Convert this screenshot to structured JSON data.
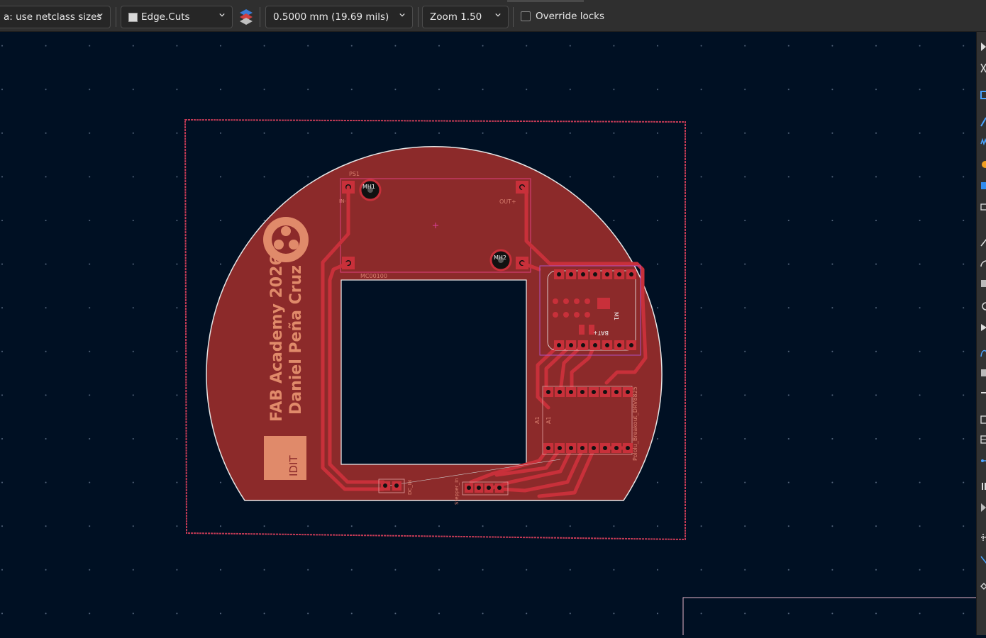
{
  "toolbar": {
    "track_size": "a: use netclass sizes",
    "layer": "Edge.Cuts",
    "grid": "0.5000 mm (19.69 mils)",
    "zoom": "Zoom 1.50",
    "override_locks": "Override locks",
    "override_locks_checked": false
  },
  "board": {
    "silk_title": "FAB Academy 2026",
    "silk_author": "Daniel Peña Cruz",
    "logo_text": "IDIT",
    "refs": {
      "ps1": "PS1",
      "mh1": "MH1",
      "mh2": "MH2",
      "out_plus": "OUT+",
      "in_minus": "IN-",
      "display": "MC00100",
      "dc_in": "DC_IN",
      "stepper": "Stepper_In",
      "a1": "A1",
      "a1b": "A1",
      "driver": "Pololu_Breakout_DRV8825",
      "m1": "M1",
      "bat": "BAT+"
    }
  },
  "colors": {
    "canvas_bg": "#001023",
    "board_fill": "#8c2a2a",
    "trace": "#c8303a",
    "edge_cut": "#dcdcdc",
    "courtyard": "#e04080",
    "silk": "#e08a6a"
  }
}
